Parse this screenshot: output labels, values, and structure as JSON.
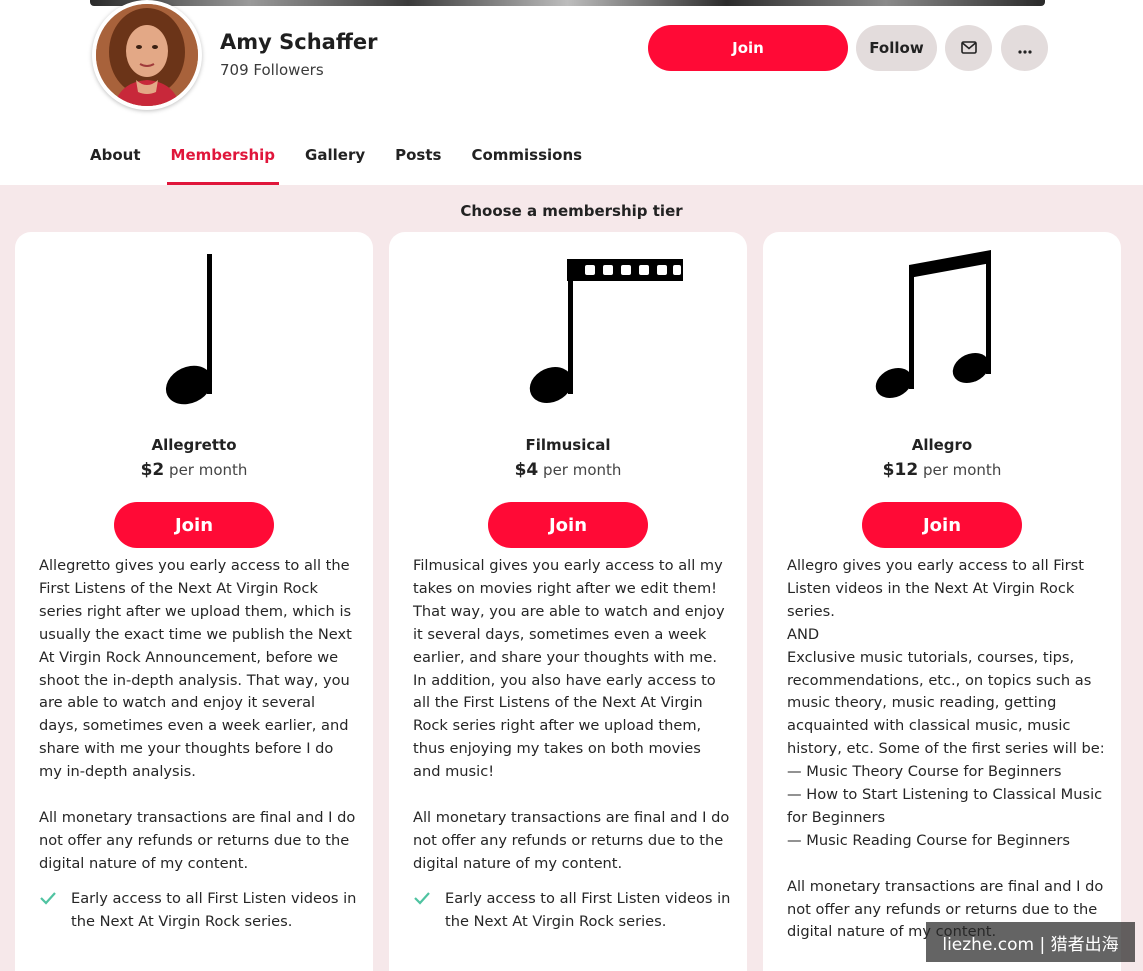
{
  "profile": {
    "name": "Amy Schaffer",
    "followers": "709 Followers"
  },
  "actions": {
    "join_label": "Join",
    "follow_label": "Follow"
  },
  "tabs": [
    {
      "label": "About",
      "active": false
    },
    {
      "label": "Membership",
      "active": true
    },
    {
      "label": "Gallery",
      "active": false
    },
    {
      "label": "Posts",
      "active": false
    },
    {
      "label": "Commissions",
      "active": false
    }
  ],
  "membership": {
    "heading": "Choose a membership tier",
    "tiers": [
      {
        "name": "Allegretto",
        "currency": "$",
        "amount": "2",
        "period": "per month",
        "join_label": "Join",
        "description": "Allegretto gives you early access to all the First Listens of the Next At Virgin Rock series right after we upload them, which is usually the exact time we publish the Next At Virgin Rock Announcement, before we shoot the in-depth analysis. That way, you are able to watch and enjoy it several days, sometimes even a week earlier, and share with me your thoughts before I do my in-depth analysis.",
        "policy": "All monetary transactions are final and I do not offer any refunds or returns due to the digital nature of my content.",
        "benefits": [
          "Early access to all First Listen videos in the Next At Virgin Rock series."
        ],
        "art": "quarter-note-icon"
      },
      {
        "name": "Filmusical",
        "currency": "$",
        "amount": "4",
        "period": "per month",
        "join_label": "Join",
        "description": "Filmusical gives you early access to all my takes on movies right after we edit them! That way, you are able to watch and enjoy it several days, sometimes even a week earlier, and share your thoughts with me. In addition, you also have early access to all the First Listens of the Next At Virgin Rock series right after we upload them, thus enjoying my takes on both movies and music!",
        "policy": "All monetary transactions are final and I do not offer any refunds or returns due to the digital nature of my content.",
        "benefits": [
          "Early access to all First Listen videos in the Next At Virgin Rock series."
        ],
        "art": "film-strip-note-icon"
      },
      {
        "name": "Allegro",
        "currency": "$",
        "amount": "12",
        "period": "per month",
        "join_label": "Join",
        "description": "Allegro gives you early access to all First Listen videos in the Next At Virgin Rock series.\nAND\nExclusive music tutorials, courses, tips, recommendations, etc., on topics such as music theory, music reading, getting acquainted with classical music, music history, etc. Some of the first series will be:\n— Music Theory Course for Beginners\n— How to Start Listening to Classical Music for Beginners\n— Music Reading Course for Beginners",
        "policy": "All monetary transactions are final and I do not offer any refunds or returns due to the digital nature of my content.",
        "benefits": [],
        "art": "beamed-eighth-notes-icon"
      }
    ]
  },
  "watermark": "liezhe.com | 猎者出海",
  "colors": {
    "accent": "#ff0a36",
    "tab_active": "#e0163b",
    "content_bg": "#f6e8ea",
    "check": "#4fc3a1"
  }
}
